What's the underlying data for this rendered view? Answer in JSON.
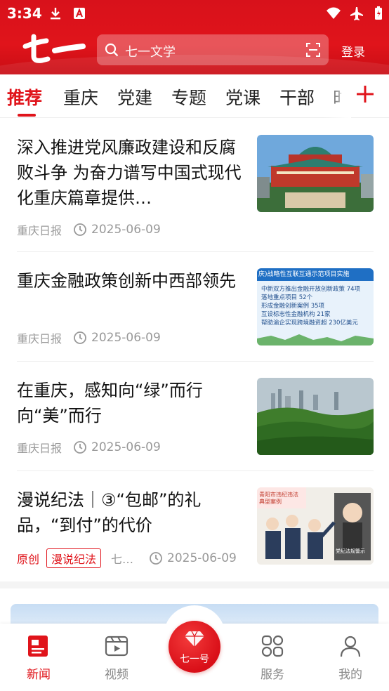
{
  "status_bar": {
    "time": "3:34"
  },
  "header": {
    "search_placeholder": "七一文学",
    "login_label": "登录"
  },
  "tabs": [
    "推荐",
    "重庆",
    "党建",
    "专题",
    "党课",
    "干部",
    "时"
  ],
  "articles": [
    {
      "title": "深入推进党风廉政建设和反腐败斗争 为奋力谱写中国式现代化重庆篇章提供…",
      "source": "重庆日报",
      "date": "2025-06-09"
    },
    {
      "title": "重庆金融政策创新中西部领先",
      "source": "重庆日报",
      "date": "2025-06-09",
      "thumb_text": {
        "header": "庆)战略性互联互通示范项目实施",
        "lines": [
          "中新双方推出金融开放创新政策 74项",
          "落地重点项目 52个",
          "形成金融创新案例 35项",
          "互设标志性金融机构 21家",
          "帮助渝企实现跨境融资超 230亿美元"
        ]
      }
    },
    {
      "title": "在重庆，感知向“绿”而行向“美”而行",
      "source": "重庆日报",
      "date": "2025-06-09"
    },
    {
      "title": "漫说纪法｜③“包邮”的礼品，“到付”的代价",
      "badge_original": "原创",
      "tag": "漫说纪法",
      "source": "七…",
      "date": "2025-06-09",
      "thumb_text": {
        "sign": "青阳市违纪违法典型案例",
        "board": "党纪法规警示"
      }
    }
  ],
  "bottom_nav": [
    {
      "label": "新闻",
      "icon": "news-icon",
      "active": true
    },
    {
      "label": "视频",
      "icon": "video-icon",
      "active": false
    },
    {
      "label": "七一号",
      "icon": "gem-icon",
      "active": false
    },
    {
      "label": "服务",
      "icon": "grid-icon",
      "active": false
    },
    {
      "label": "我的",
      "icon": "user-icon",
      "active": false
    }
  ],
  "colors": {
    "brand_red": "#e0141b",
    "meta_gray": "#999999"
  }
}
